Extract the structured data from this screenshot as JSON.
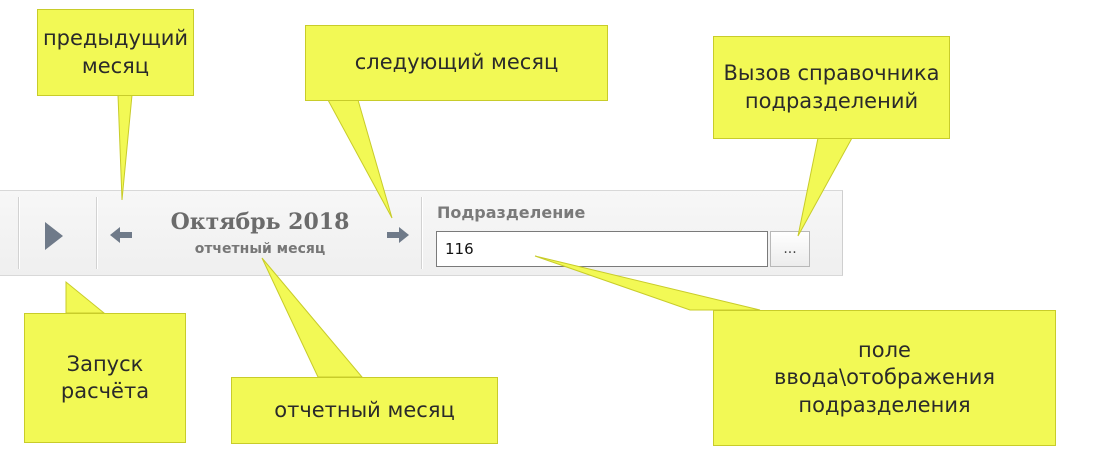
{
  "toolbar": {
    "run_icon": "play-triangle-icon",
    "prev_icon": "arrow-left-icon",
    "next_icon": "arrow-right-icon",
    "month_title": "Октябрь 2018",
    "month_subtitle": "отчетный месяц",
    "department_label": "Подразделение",
    "department_value": "116",
    "department_lookup_label": "...",
    "colors": {
      "background": "#f3f3f3",
      "icon": "#6f7a89"
    }
  },
  "callouts": {
    "prev_month": "предыдущий\nмесяц",
    "next_month": "следующий месяц",
    "lookup": "Вызов справочника\nподразделений",
    "run": "Запуск\nрасчёта",
    "report_month": "отчетный месяц",
    "input_field": "поле\nввода\\отображения\nподразделения",
    "colors": {
      "fill": "#f2f955"
    }
  }
}
